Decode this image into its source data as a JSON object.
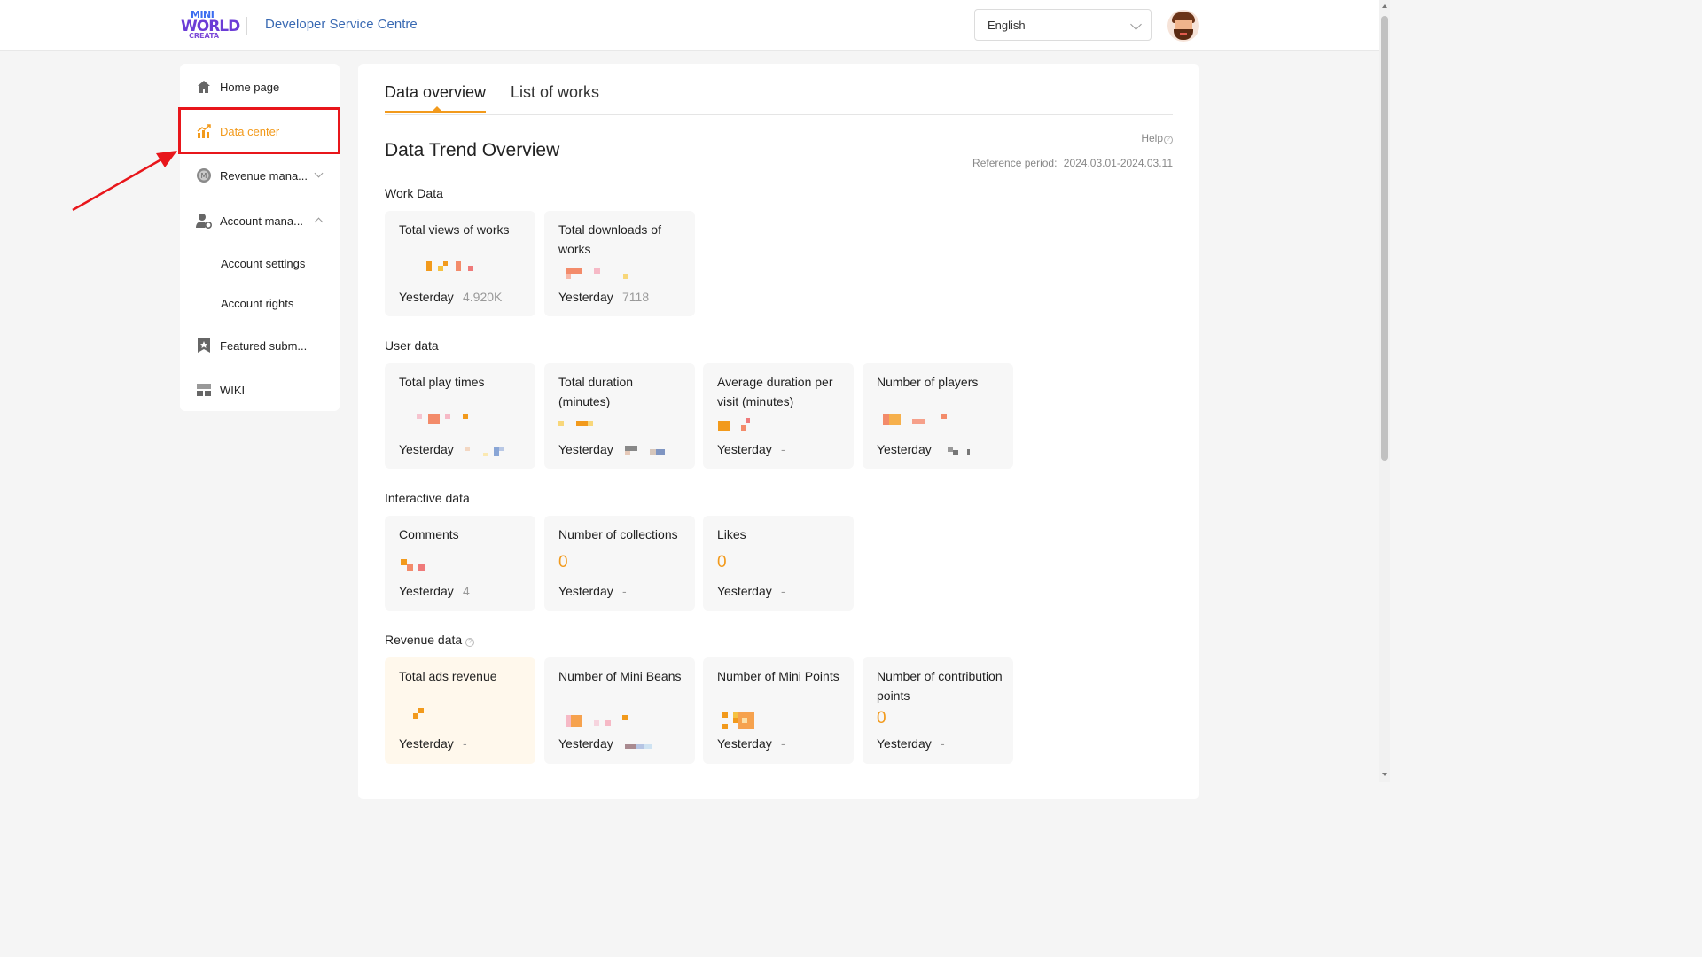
{
  "header": {
    "logo_line1": "MINI",
    "logo_line2": "WORLD",
    "logo_line3": "CREATA",
    "site_title": "Developer Service Centre",
    "language": "English"
  },
  "sidebar": {
    "items": [
      {
        "label": "Home page",
        "icon": "home-icon"
      },
      {
        "label": "Data center",
        "icon": "chart-icon",
        "active": true
      },
      {
        "label": "Revenue mana...",
        "icon": "coin-icon",
        "expandable": true,
        "expanded": false
      },
      {
        "label": "Account mana...",
        "icon": "user-settings-icon",
        "expandable": true,
        "expanded": true
      },
      {
        "label": "Featured subm...",
        "icon": "star-bookmark-icon"
      },
      {
        "label": "WIKI",
        "icon": "wiki-icon"
      }
    ],
    "subitems": [
      {
        "label": "Account settings"
      },
      {
        "label": "Account rights"
      }
    ]
  },
  "tabs": [
    {
      "label": "Data overview",
      "active": true
    },
    {
      "label": "List of works",
      "active": false
    }
  ],
  "overview": {
    "title": "Data Trend Overview",
    "help": "Help",
    "reference_label": "Reference period:",
    "reference_value": "2024.03.01-2024.03.11"
  },
  "sections": {
    "work": {
      "title": "Work Data",
      "cards": [
        {
          "name": "Total views of works",
          "yesterday_label": "Yesterday",
          "yesterday_value": "4.920K"
        },
        {
          "name": "Total downloads of works",
          "yesterday_label": "Yesterday",
          "yesterday_value": "7118"
        }
      ]
    },
    "user": {
      "title": "User data",
      "cards": [
        {
          "name": "Total play times",
          "yesterday_label": "Yesterday",
          "yesterday_value": ""
        },
        {
          "name": "Total duration (minutes)",
          "yesterday_label": "Yesterday",
          "yesterday_value": ""
        },
        {
          "name": "Average duration per visit (minutes)",
          "yesterday_label": "Yesterday",
          "yesterday_value": "-"
        },
        {
          "name": "Number of players",
          "yesterday_label": "Yesterday",
          "yesterday_value": ""
        }
      ]
    },
    "interactive": {
      "title": "Interactive data",
      "cards": [
        {
          "name": "Comments",
          "total": "",
          "yesterday_label": "Yesterday",
          "yesterday_value": "4"
        },
        {
          "name": "Number of collections",
          "total": "0",
          "yesterday_label": "Yesterday",
          "yesterday_value": "-"
        },
        {
          "name": "Likes",
          "total": "0",
          "yesterday_label": "Yesterday",
          "yesterday_value": "-"
        }
      ]
    },
    "revenue": {
      "title": "Revenue data",
      "cards": [
        {
          "name": "Total ads revenue",
          "yesterday_label": "Yesterday",
          "yesterday_value": "-"
        },
        {
          "name": "Number of Mini Beans",
          "yesterday_label": "Yesterday",
          "yesterday_value": ""
        },
        {
          "name": "Number of Mini Points",
          "yesterday_label": "Yesterday",
          "yesterday_value": "-"
        },
        {
          "name": "Number of contribution points",
          "total": "0",
          "yesterday_label": "Yesterday",
          "yesterday_value": "-"
        }
      ]
    }
  },
  "colors": {
    "accent": "#f29a1c",
    "annotation_red": "#e8161b",
    "link_blue": "#3a6ab3"
  }
}
